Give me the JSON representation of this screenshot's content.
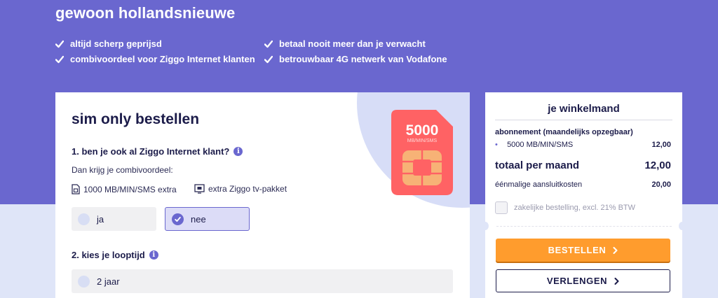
{
  "hero": {
    "title": "gewoon hollandsnieuwe",
    "usps": [
      "altijd scherp geprijsd",
      "combivoordeel voor Ziggo Internet klanten",
      "betaal nooit meer dan je verwacht",
      "betrouwbaar 4G netwerk van Vodafone"
    ]
  },
  "order": {
    "title": "sim only bestellen",
    "question1": "1. ben je ook al Ziggo Internet klant?",
    "combi_intro": "Dan krijg je combivoordeel:",
    "perks": [
      "1000 MB/MIN/SMS extra",
      "extra Ziggo tv-pakket"
    ],
    "answers": {
      "yes": "ja",
      "no": "nee",
      "selected": "nee"
    },
    "question2": "2. kies je looptijd",
    "duration_option": "2 jaar",
    "sim_amount": "5000",
    "sim_unit": "MB/MIN/SMS"
  },
  "cart": {
    "title": "je winkelmand",
    "subscription_header": "abonnement (maandelijks opzegbaar)",
    "line_item": "5000 MB/MIN/SMS",
    "line_price": "12,00",
    "total_label": "totaal per maand",
    "total_price": "12,00",
    "onetime_label": "éénmalige aansluitkosten",
    "onetime_price": "20,00",
    "business_checkbox": "zakelijke bestelling, excl. 21% BTW",
    "order_button": "BESTELLEN",
    "renew_button": "VERLENGEN"
  },
  "colors": {
    "hero_bg": "#6a67cf",
    "accent_orange": "#ff9c2d",
    "sim_red": "#ff6264",
    "dark_text": "#1c1c4a"
  },
  "icons": [
    "checkmark-icon",
    "info-icon",
    "sim-card-icon",
    "tv-icon",
    "chevron-right-icon"
  ]
}
